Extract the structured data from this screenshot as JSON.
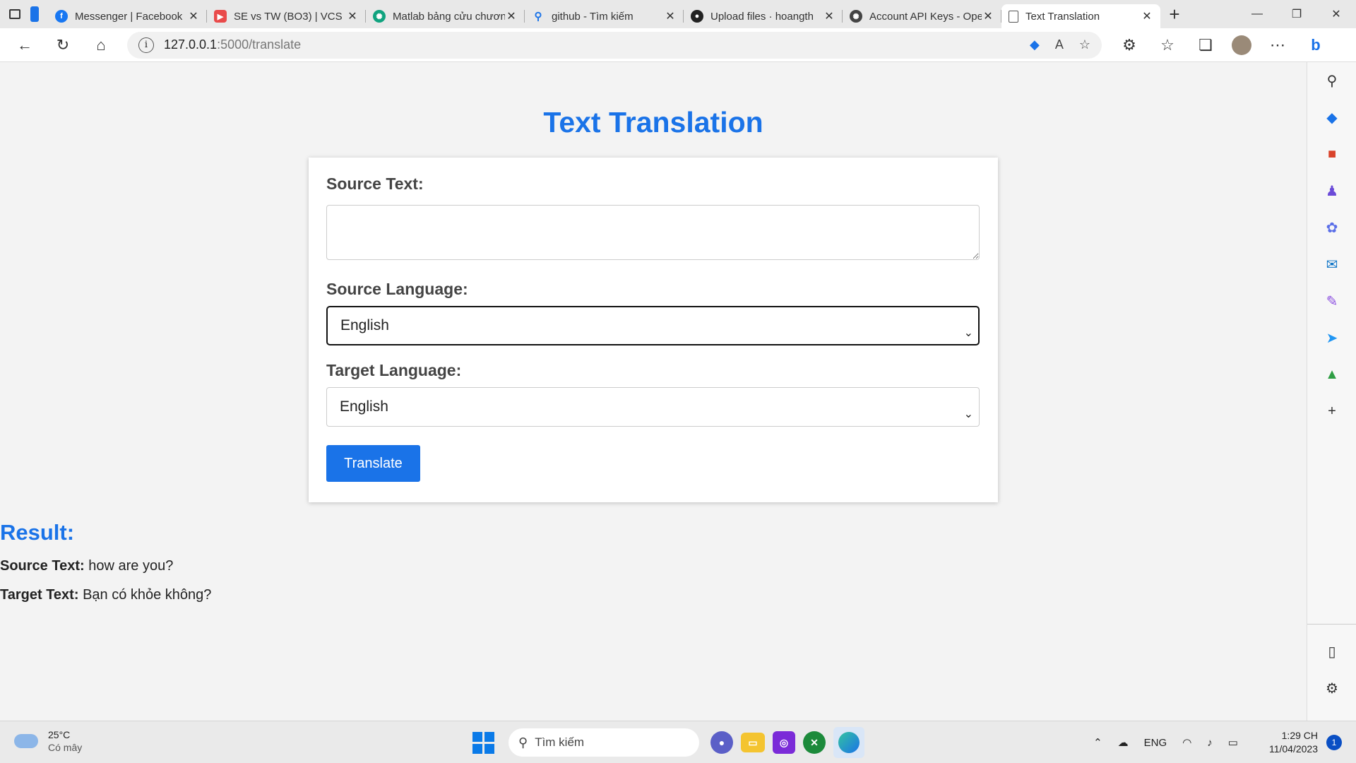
{
  "browser": {
    "tabs": [
      {
        "title": "Messenger | Facebook",
        "icon": "facebook-icon",
        "color": "#1877f2"
      },
      {
        "title": "SE vs TW (BO3) | VCS",
        "icon": "youtube-icon",
        "color": "#e94a4a"
      },
      {
        "title": "Matlab bảng cửu chương",
        "icon": "chatgpt-icon",
        "color": "#10a37f"
      },
      {
        "title": "github - Tìm kiếm",
        "icon": "search-icon",
        "color": "#1a73e8"
      },
      {
        "title": "Upload files · hoangth",
        "icon": "github-icon",
        "color": "#222222"
      },
      {
        "title": "Account API Keys - OpenAI",
        "icon": "openai-icon",
        "color": "#444444"
      },
      {
        "title": "Text Translation",
        "icon": "page-icon",
        "color": "#555555"
      }
    ],
    "address": {
      "host": "127.0.0.1",
      "rest": ":5000/translate"
    }
  },
  "page": {
    "title": "Text Translation",
    "source_text_label": "Source Text:",
    "source_text_value": "",
    "source_language_label": "Source Language:",
    "source_language_value": "English",
    "target_language_label": "Target Language:",
    "target_language_value": "English",
    "translate_button": "Translate"
  },
  "result": {
    "heading": "Result:",
    "source_label": "Source Text:",
    "source_value": "how are you?",
    "target_label": "Target Text:",
    "target_value": "Bạn có khỏe không?"
  },
  "taskbar": {
    "weather_temp": "25°C",
    "weather_desc": "Có mây",
    "search_placeholder": "Tìm kiếm",
    "language": "ENG",
    "time": "1:29 CH",
    "date": "11/04/2023",
    "notifications": "1"
  },
  "colors": {
    "accent": "#1a73e8"
  }
}
